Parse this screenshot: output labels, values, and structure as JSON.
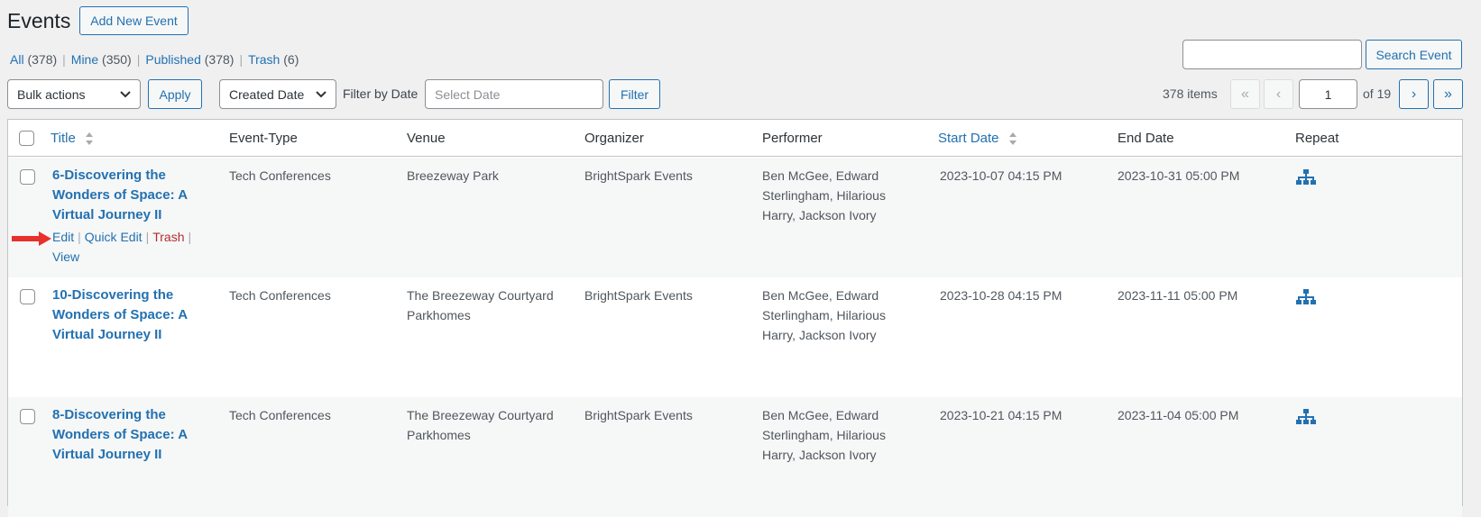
{
  "header": {
    "title": "Events",
    "add_new_label": "Add New Event"
  },
  "views": [
    {
      "label": "All",
      "count": "(378)"
    },
    {
      "label": "Mine",
      "count": "(350)"
    },
    {
      "label": "Published",
      "count": "(378)"
    },
    {
      "label": "Trash",
      "count": "(6)"
    }
  ],
  "search": {
    "value": "",
    "button_label": "Search Event"
  },
  "toolbar": {
    "bulk_actions": "Bulk actions",
    "apply_label": "Apply",
    "sort_select": "Created Date",
    "filter_by_date_label": "Filter by Date",
    "date_placeholder": "Select Date",
    "filter_label": "Filter"
  },
  "pagination": {
    "items_count": "378 items",
    "first": "«",
    "prev": "‹",
    "current_page": "1",
    "of_pages": "of 19",
    "next": "›",
    "last": "»"
  },
  "table": {
    "columns": {
      "title": "Title",
      "event_type": "Event-Type",
      "venue": "Venue",
      "organizer": "Organizer",
      "performer": "Performer",
      "start_date": "Start Date",
      "end_date": "End Date",
      "repeat": "Repeat"
    },
    "row_actions": {
      "edit": "Edit",
      "quick_edit": "Quick Edit",
      "trash": "Trash",
      "view": "View"
    },
    "rows": [
      {
        "title_lines": [
          "6-Discovering the",
          "Wonders of Space: A",
          "Virtual Journey II"
        ],
        "event_type": "Tech Conferences",
        "venue_lines": [
          "Breezeway Park"
        ],
        "organizer": "BrightSpark Events",
        "performer_lines": [
          "Ben McGee, Edward",
          "Sterlingham, Hilarious",
          "Harry, Jackson Ivory"
        ],
        "start_date": "2023-10-07 04:15 PM",
        "end_date": "2023-10-31 05:00 PM"
      },
      {
        "title_lines": [
          "10-Discovering the",
          "Wonders of Space: A",
          "Virtual Journey II"
        ],
        "event_type": "Tech Conferences",
        "venue_lines": [
          "The Breezeway Courtyard",
          "Parkhomes"
        ],
        "organizer": "BrightSpark Events",
        "performer_lines": [
          "Ben McGee, Edward",
          "Sterlingham, Hilarious",
          "Harry, Jackson Ivory"
        ],
        "start_date": "2023-10-28 04:15 PM",
        "end_date": "2023-11-11 05:00 PM"
      },
      {
        "title_lines": [
          "8-Discovering the",
          "Wonders of Space: A",
          "Virtual Journey II"
        ],
        "event_type": "Tech Conferences",
        "venue_lines": [
          "The Breezeway Courtyard",
          "Parkhomes"
        ],
        "organizer": "BrightSpark Events",
        "performer_lines": [
          "Ben McGee, Edward",
          "Sterlingham, Hilarious",
          "Harry, Jackson Ivory"
        ],
        "start_date": "2023-10-21 04:15 PM",
        "end_date": "2023-11-04 05:00 PM"
      }
    ]
  },
  "colors": {
    "link": "#2271b1",
    "trash": "#b32d2e",
    "arrow": "#e8302d",
    "alt_row": "#f6f7f7"
  },
  "icons": {
    "repeat": "sitemap-icon",
    "annotation": "red-arrow-icon"
  }
}
